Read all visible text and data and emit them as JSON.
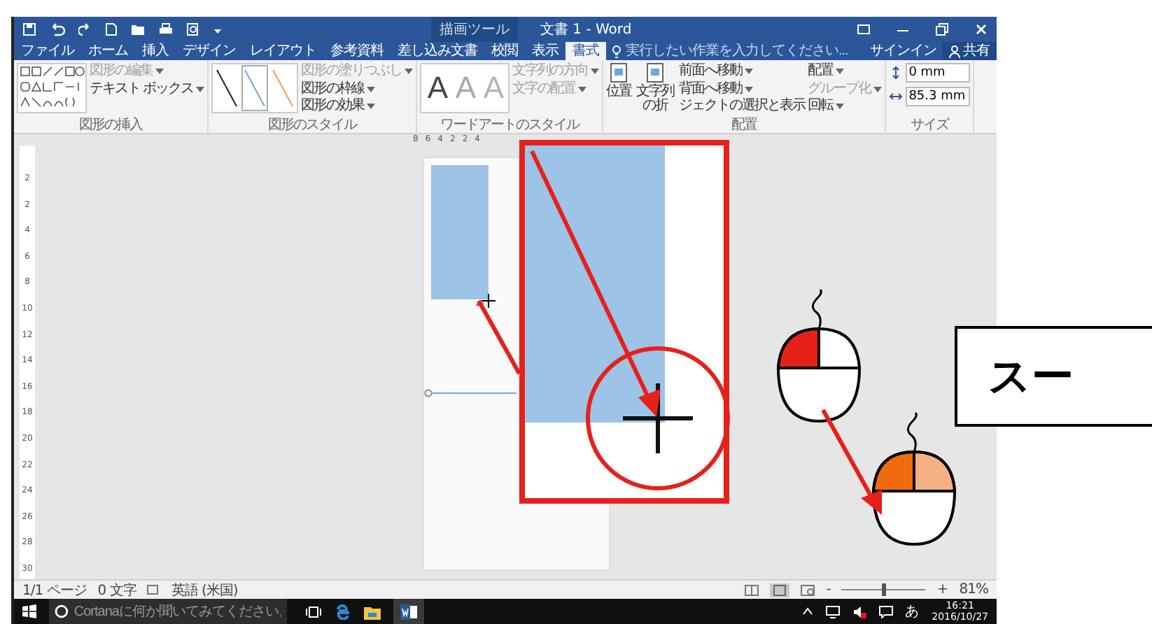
{
  "title_bar": {
    "context_label": "描画ツール",
    "title": "文書 1 - Word"
  },
  "tabs": [
    {
      "label": "ファイル",
      "selected": false
    },
    {
      "label": "ホーム",
      "selected": false
    },
    {
      "label": "挿入",
      "selected": false
    },
    {
      "label": "デザイン",
      "selected": false
    },
    {
      "label": "レイアウト",
      "selected": false
    },
    {
      "label": "参考資料",
      "selected": false
    },
    {
      "label": "差し込み文書",
      "selected": false
    },
    {
      "label": "校閲",
      "selected": false
    },
    {
      "label": "表示",
      "selected": false
    },
    {
      "label": "書式",
      "selected": true
    }
  ],
  "tell_me": {
    "placeholder": "実行したい作業を入力してください..."
  },
  "account": {
    "sign_in": "サインイン",
    "share": "共有"
  },
  "ribbon": {
    "groups": [
      {
        "kind": "insert_shapes",
        "label": "図形の挿入",
        "buttons": [
          {
            "label": "図形の編集",
            "dropdown": true,
            "disabled": true
          },
          {
            "label": "テキスト ボックス",
            "dropdown": true,
            "disabled": false
          }
        ]
      },
      {
        "kind": "shape_styles",
        "label": "図形のスタイル",
        "buttons": [
          {
            "label": "図形の塗りつぶし",
            "dropdown": true,
            "disabled": true
          },
          {
            "label": "図形の枠線",
            "dropdown": true,
            "disabled": false
          },
          {
            "label": "図形の効果",
            "dropdown": true,
            "disabled": false
          }
        ]
      },
      {
        "kind": "wordart",
        "label": "ワードアートのスタイル",
        "letters": [
          "A",
          "A",
          "A"
        ],
        "buttons": [
          {
            "label": "文字列の方向",
            "dropdown": true,
            "disabled": true
          },
          {
            "label": "文字の配置",
            "dropdown": true,
            "disabled": true
          }
        ]
      },
      {
        "kind": "arrange",
        "label": "配置",
        "large_buttons": [
          "位置",
          "文字列の折"
        ],
        "buttons": [
          {
            "label": "前面へ移動",
            "dropdown": true,
            "disabled": false
          },
          {
            "label": "背面へ移動",
            "dropdown": true,
            "disabled": false
          },
          {
            "label": "ジェクトの選択と表示",
            "dropdown": false,
            "disabled": false
          },
          {
            "label": "配置",
            "dropdown": true,
            "disabled": false
          },
          {
            "label": "グループ化",
            "dropdown": true,
            "disabled": true
          },
          {
            "label": "回転",
            "dropdown": true,
            "disabled": false
          }
        ]
      },
      {
        "kind": "size",
        "label": "サイズ",
        "fields": [
          "0 mm",
          "85.3 mm"
        ]
      }
    ]
  },
  "horizontal_ruler": [
    "8",
    "6",
    "4",
    "2",
    "2",
    "4"
  ],
  "vertical_ruler": [
    "2",
    "2",
    "4",
    "6",
    "8",
    "10",
    "12",
    "14",
    "16",
    "18",
    "20",
    "22",
    "24",
    "26",
    "28",
    "30"
  ],
  "status_bar": {
    "page": "1/1 ページ",
    "words": "0 文字",
    "language": "英語 (米国)",
    "zoom_out": "-",
    "zoom_slider": {
      "level": 0.5
    },
    "zoom_in": "+",
    "zoom": "81%"
  },
  "taskbar": {
    "search_placeholder": "Cortanaに何か聞いてみてください。",
    "ime": "あ",
    "time": "16:21",
    "date": "2016/10/27"
  },
  "callout": {
    "text": "スー"
  }
}
